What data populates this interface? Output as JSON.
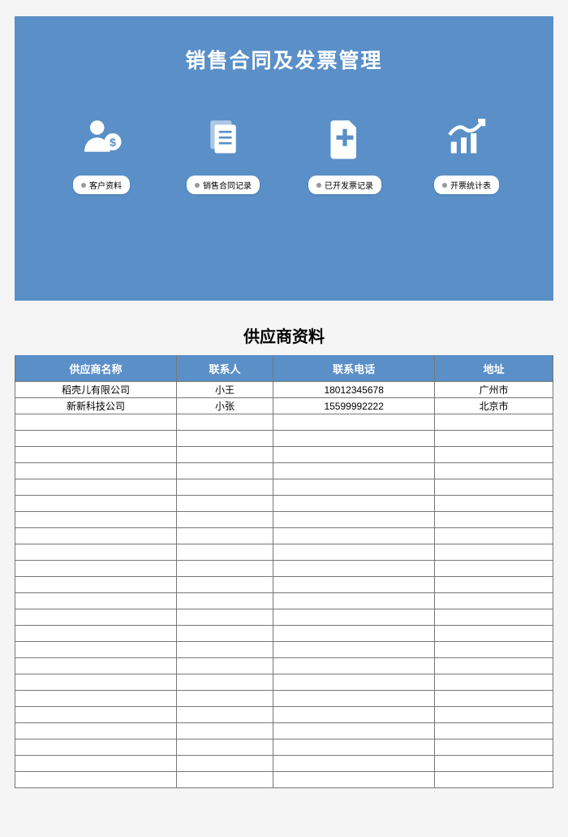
{
  "header": {
    "title": "销售合同及发票管理"
  },
  "nav": [
    {
      "label": "客户资料"
    },
    {
      "label": "销售合同记录"
    },
    {
      "label": "已开发票记录"
    },
    {
      "label": "开票统计表"
    }
  ],
  "section_title": "供应商资料",
  "table": {
    "columns": [
      "供应商名称",
      "联系人",
      "联系电话",
      "地址"
    ],
    "rows": [
      {
        "name": "稻壳儿有限公司",
        "contact": "小王",
        "phone": "18012345678",
        "address": "广州市"
      },
      {
        "name": "新新科技公司",
        "contact": "小张",
        "phone": "15599992222",
        "address": "北京市"
      }
    ],
    "empty_row_count": 23
  }
}
